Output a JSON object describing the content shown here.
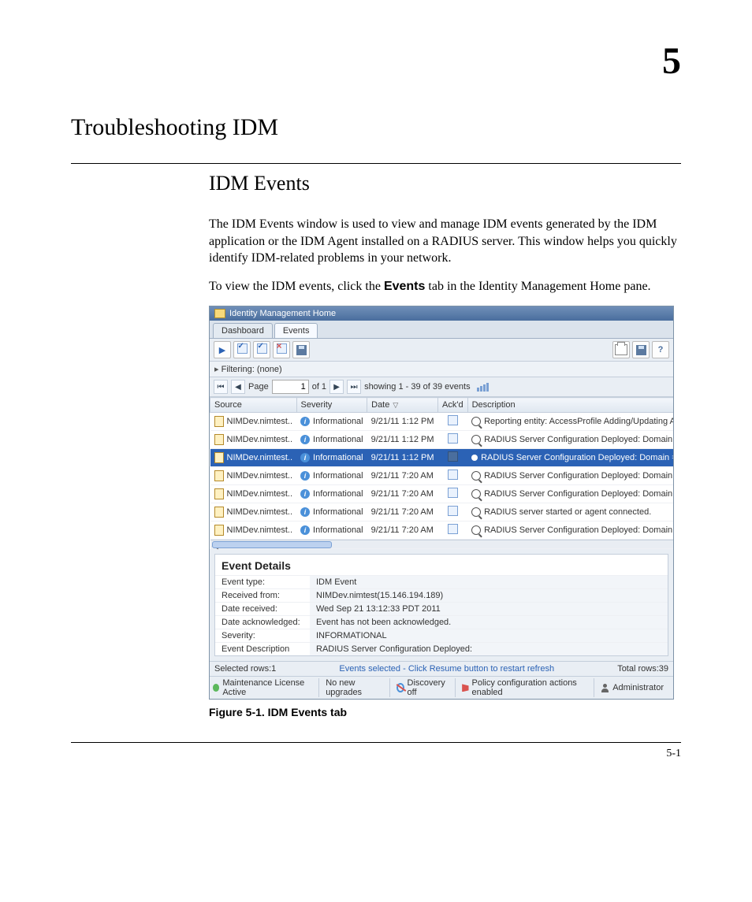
{
  "chapter_number": "5",
  "chapter_title": "Troubleshooting IDM",
  "section_title": "IDM Events",
  "paragraph1": "The IDM Events window is used to view and manage IDM events generated by the IDM application or the IDM Agent installed on a RADIUS server. This window helps you quickly identify IDM-related problems in your network.",
  "paragraph2_prefix": "To view the IDM events, click the ",
  "paragraph2_bold": "Events",
  "paragraph2_suffix": " tab in the Identity Management Home pane.",
  "figure_caption": "Figure 5-1. IDM Events tab",
  "page_number": "5-1",
  "screenshot": {
    "window_title": "Identity Management Home",
    "tabs": [
      "Dashboard",
      "Events"
    ],
    "active_tab_index": 1,
    "filter_label": "Filtering:",
    "filter_value": "(none)",
    "paging": {
      "page_label": "Page",
      "page_value": "1",
      "of_label": "of 1",
      "showing": "showing 1 - 39 of 39 events"
    },
    "columns": [
      "Source",
      "Severity",
      "Date",
      "Ack'd",
      "Description"
    ],
    "sorted_col_index": 2,
    "rows": [
      {
        "source": "NIMDev.nimtest..",
        "severity": "Informational",
        "date": "9/21/11 1:12 PM",
        "desc": "Reporting entity: AccessProfile Adding/Updating A",
        "selected": false
      },
      {
        "source": "NIMDev.nimtest..",
        "severity": "Informational",
        "date": "9/21/11 1:12 PM",
        "desc": "RADIUS Server Configuration Deployed: Domain =",
        "selected": false
      },
      {
        "source": "NIMDev.nimtest..",
        "severity": "Informational",
        "date": "9/21/11 1:12 PM",
        "desc": "RADIUS Server Configuration Deployed: Domain =",
        "selected": true
      },
      {
        "source": "NIMDev.nimtest..",
        "severity": "Informational",
        "date": "9/21/11 7:20 AM",
        "desc": "RADIUS Server Configuration Deployed: Domain =",
        "selected": false
      },
      {
        "source": "NIMDev.nimtest..",
        "severity": "Informational",
        "date": "9/21/11 7:20 AM",
        "desc": "RADIUS Server Configuration Deployed: Domain =",
        "selected": false
      },
      {
        "source": "NIMDev.nimtest..",
        "severity": "Informational",
        "date": "9/21/11 7:20 AM",
        "desc": "RADIUS server started or agent connected.",
        "selected": false
      },
      {
        "source": "NIMDev.nimtest..",
        "severity": "Informational",
        "date": "9/21/11 7:20 AM",
        "desc": "RADIUS Server Configuration Deployed: Domain =",
        "selected": false
      }
    ],
    "details": {
      "title": "Event Details",
      "rows": [
        [
          "Event type:",
          "IDM Event"
        ],
        [
          "Received from:",
          "NIMDev.nimtest(15.146.194.189)"
        ],
        [
          "Date received:",
          "Wed Sep 21 13:12:33 PDT 2011"
        ],
        [
          "Date acknowledged:",
          "Event has not been acknowledged."
        ],
        [
          "Severity:",
          "INFORMATIONAL"
        ],
        [
          "Event Description",
          "RADIUS Server Configuration Deployed:"
        ]
      ]
    },
    "status": {
      "selected": "Selected rows:1",
      "mid": "Events selected - Click Resume button to restart refresh",
      "total": "Total rows:39"
    },
    "footer": {
      "license": "Maintenance License Active",
      "upgrades": "No new upgrades",
      "discovery": "Discovery off",
      "policy": "Policy configuration actions enabled",
      "admin": "Administrator"
    }
  }
}
